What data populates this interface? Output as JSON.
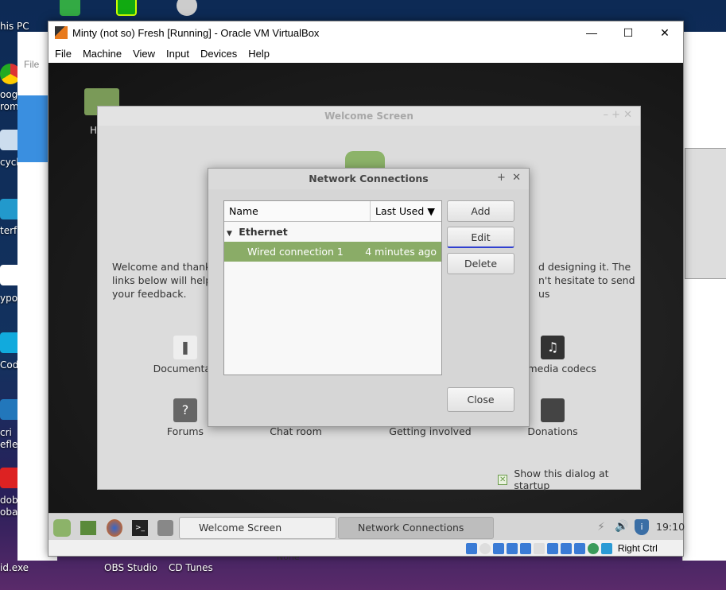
{
  "desktop": {
    "labels": [
      "his PC",
      "oogl",
      "rome",
      "cycle",
      "terf",
      "ypor",
      "Codi",
      "cri",
      "efle",
      "dob",
      "obat",
      "id.exe",
      "OBS Studio",
      "CD Tunes"
    ],
    "bg_window_menu": "File",
    "bg_window_text": "None"
  },
  "vbox": {
    "title": "Minty (not so) Fresh [Running] - Oracle VM VirtualBox",
    "menu": [
      "File",
      "Machine",
      "View",
      "Input",
      "Devices",
      "Help"
    ],
    "host_key": "Right Ctrl"
  },
  "vm": {
    "home_label": "H",
    "welcome": {
      "title": "Welcome Screen",
      "text_left": [
        "Welcome and thank y",
        "links below will help y",
        "your feedback."
      ],
      "text_right": [
        "d designing it. The",
        "n't hesitate to send us"
      ],
      "links": [
        "Documentati",
        "imedia codecs",
        "Forums",
        "Chat room",
        "Getting involved",
        "Donations"
      ],
      "show_startup": "Show this dialog at startup",
      "show_startup_checked": true
    },
    "network": {
      "title": "Network Connections",
      "columns": [
        "Name",
        "Last Used"
      ],
      "group": "Ethernet",
      "rows": [
        {
          "name": "Wired connection 1",
          "last_used": "4 minutes ago",
          "selected": true
        }
      ],
      "buttons": {
        "add": "Add",
        "edit": "Edit",
        "delete": "Delete",
        "close": "Close"
      }
    },
    "panel": {
      "tasks": [
        "Welcome Screen",
        "Network Connections"
      ],
      "clock": "19:10"
    }
  },
  "colors": {
    "mint_green": "#8cb369",
    "selected_row": "#8aac67"
  }
}
